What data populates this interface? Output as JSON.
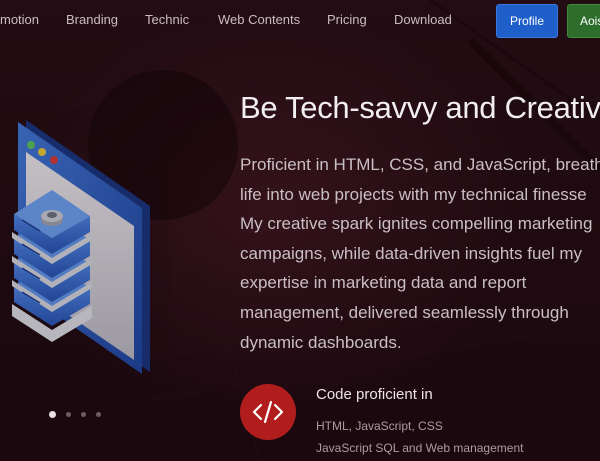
{
  "nav": {
    "items": [
      "motion",
      "Branding",
      "Technic",
      "Web Contents",
      "Pricing",
      "Download"
    ],
    "profile_label": "Profile",
    "second_button_label": "Aois"
  },
  "hero": {
    "title": "Be Tech-savvy and Creativ",
    "paragraph_lines": [
      "Proficient in HTML, CSS, and JavaScript, breath",
      "life into web projects with my technical finesse",
      "My creative spark ignites compelling marketing",
      "campaigns, while data-driven insights fuel my",
      "expertise in marketing data and report",
      "management, delivered seamlessly through",
      "dynamic dashboards."
    ]
  },
  "feature": {
    "icon": "code-icon",
    "icon_text": "</>",
    "title": "Code proficient in",
    "lines": [
      "HTML, JavaScript, CSS",
      "JavaScript  SQL and Web management"
    ]
  },
  "carousel": {
    "slide_count": 4,
    "active_index": 0
  },
  "colors": {
    "background": "#1e0a10",
    "profile_button": "#1f5fc9",
    "green_button": "#2e6e2c",
    "icon_circle": "#b11c1c"
  }
}
